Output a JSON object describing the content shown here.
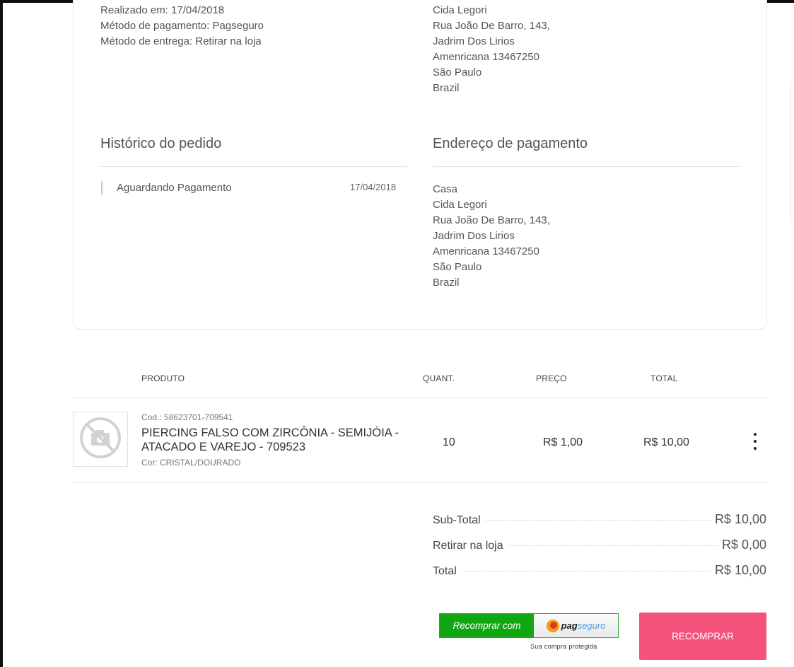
{
  "order": {
    "lines": [
      "Realizado em: 17/04/2018",
      "Método de pagamento: Pagseguro",
      "Método de entrega: Retirar na loja"
    ]
  },
  "shipping_address": {
    "lines": [
      "Cida Legori",
      "Rua João De Barro, 143,",
      "Jadrim Dos Lirios",
      "Amenricana 13467250",
      "São Paulo",
      "Brazil"
    ]
  },
  "history": {
    "title": "Histórico do pedido",
    "entries": [
      {
        "status": "Aguardando Pagamento",
        "date": "17/04/2018"
      }
    ]
  },
  "payment_address": {
    "title": "Endereço de pagamento",
    "lines": [
      "Casa",
      "Cida Legori",
      "Rua João De Barro, 143,",
      "Jadrim Dos Lirios",
      "Amenricana 13467250",
      "São Paulo",
      "Brazil"
    ]
  },
  "table": {
    "headers": {
      "product": "PRODUTO",
      "quantity": "QUANT.",
      "price": "PREÇO",
      "total": "TOTAL"
    },
    "rows": [
      {
        "code": "Cod.: 58623701-709541",
        "name": "PIERCING FALSO COM ZIRCÔNIA - SEMIJÓIA - ATACADO E VAREJO - 709523",
        "color": "Cor: CRISTAL/DOURADO",
        "quantity": "10",
        "price": "R$ 1,00",
        "total": "R$ 10,00",
        "image_icon": "no-photo-icon"
      }
    ]
  },
  "summary": {
    "subtotal_label": "Sub-Total",
    "subtotal_value": "R$ 10,00",
    "shipping_label": "Retirar na loja",
    "shipping_value": "R$ 0,00",
    "total_label": "Total",
    "total_value": "R$ 10,00"
  },
  "actions": {
    "pagseguro_left": "Recomprar com",
    "pagseguro_brand_a": "pag",
    "pagseguro_brand_b": "seguro",
    "pagseguro_note": "Sua compra protegida",
    "recomprar_label": "RECOMPRAR"
  },
  "colors": {
    "accent_pink": "#f5527c",
    "pagseguro_green": "#12a712"
  }
}
